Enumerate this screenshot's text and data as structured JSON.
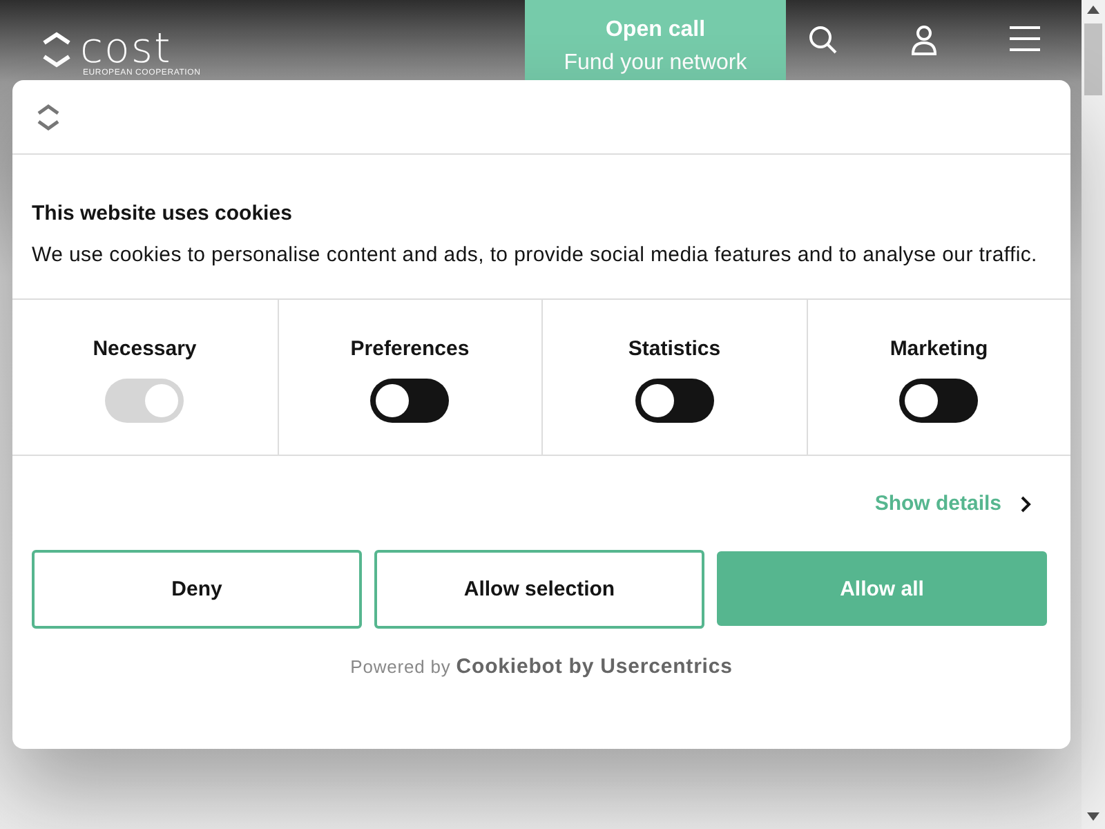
{
  "header": {
    "logo": {
      "wordmark": "cost",
      "tagline": "EUROPEAN COOPERATION"
    },
    "open_call": {
      "title": "Open call",
      "subtitle": "Fund your network"
    }
  },
  "cookie_dialog": {
    "heading": "This website uses cookies",
    "body": "We use cookies to personalise content and ads, to provide social media features and to analyse our traffic.",
    "categories": [
      {
        "label": "Necessary",
        "checked": true,
        "disabled": true
      },
      {
        "label": "Preferences",
        "checked": false,
        "disabled": false
      },
      {
        "label": "Statistics",
        "checked": false,
        "disabled": false
      },
      {
        "label": "Marketing",
        "checked": false,
        "disabled": false
      }
    ],
    "details_link": "Show details",
    "buttons": [
      {
        "label": "Deny",
        "kind": "outline"
      },
      {
        "label": "Allow selection",
        "kind": "outline"
      },
      {
        "label": "Allow all",
        "kind": "primary"
      }
    ],
    "powered_by": "Powered by **Cookiebot by Usercentrics**"
  }
}
